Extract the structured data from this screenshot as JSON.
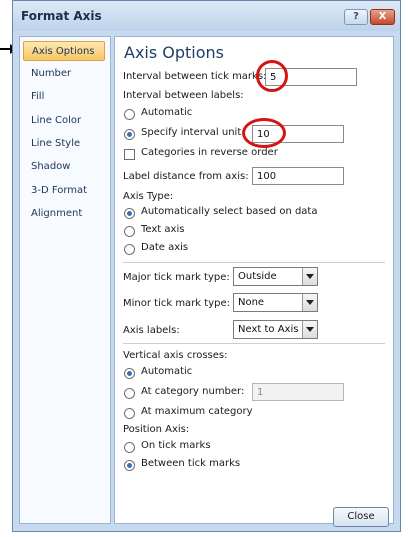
{
  "window": {
    "title": "Format Axis",
    "help_label": "?",
    "close_label": "X"
  },
  "sidebar": {
    "items": [
      {
        "label": "Axis Options",
        "selected": true
      },
      {
        "label": "Number",
        "selected": false
      },
      {
        "label": "Fill",
        "selected": false
      },
      {
        "label": "Line Color",
        "selected": false
      },
      {
        "label": "Line Style",
        "selected": false
      },
      {
        "label": "Shadow",
        "selected": false
      },
      {
        "label": "3-D Format",
        "selected": false
      },
      {
        "label": "Alignment",
        "selected": false
      }
    ]
  },
  "panel": {
    "title": "Axis Options",
    "tick_interval": {
      "label": "Interval between tick marks:",
      "value": "5"
    },
    "label_interval": {
      "label": "Interval between labels:",
      "automatic_label": "Automatic",
      "specify_label": "Specify interval unit:",
      "specify_value": "10",
      "selected": "specify"
    },
    "reverse_order": {
      "label": "Categories in reverse order",
      "checked": false
    },
    "label_distance": {
      "label": "Label distance from axis:",
      "value": "100"
    },
    "axis_type": {
      "heading": "Axis Type:",
      "options": [
        "Automatically select based on data",
        "Text axis",
        "Date axis"
      ],
      "selected": 0
    },
    "major_tick": {
      "label": "Major tick mark type:",
      "value": "Outside"
    },
    "minor_tick": {
      "label": "Minor tick mark type:",
      "value": "None"
    },
    "axis_labels": {
      "label": "Axis labels:",
      "value": "Next to Axis"
    },
    "vertical_crosses": {
      "heading": "Vertical axis crosses:",
      "options": [
        "Automatic",
        "At category number:",
        "At maximum category"
      ],
      "category_number_value": "1",
      "selected": 0
    },
    "position_axis": {
      "heading": "Position Axis:",
      "options": [
        "On tick marks",
        "Between tick marks"
      ],
      "selected": 1
    },
    "close_button_label": "Close"
  },
  "colors": {
    "highlight": "#d61414",
    "selection": "#f8c666",
    "frame": "#c7d9ee"
  }
}
